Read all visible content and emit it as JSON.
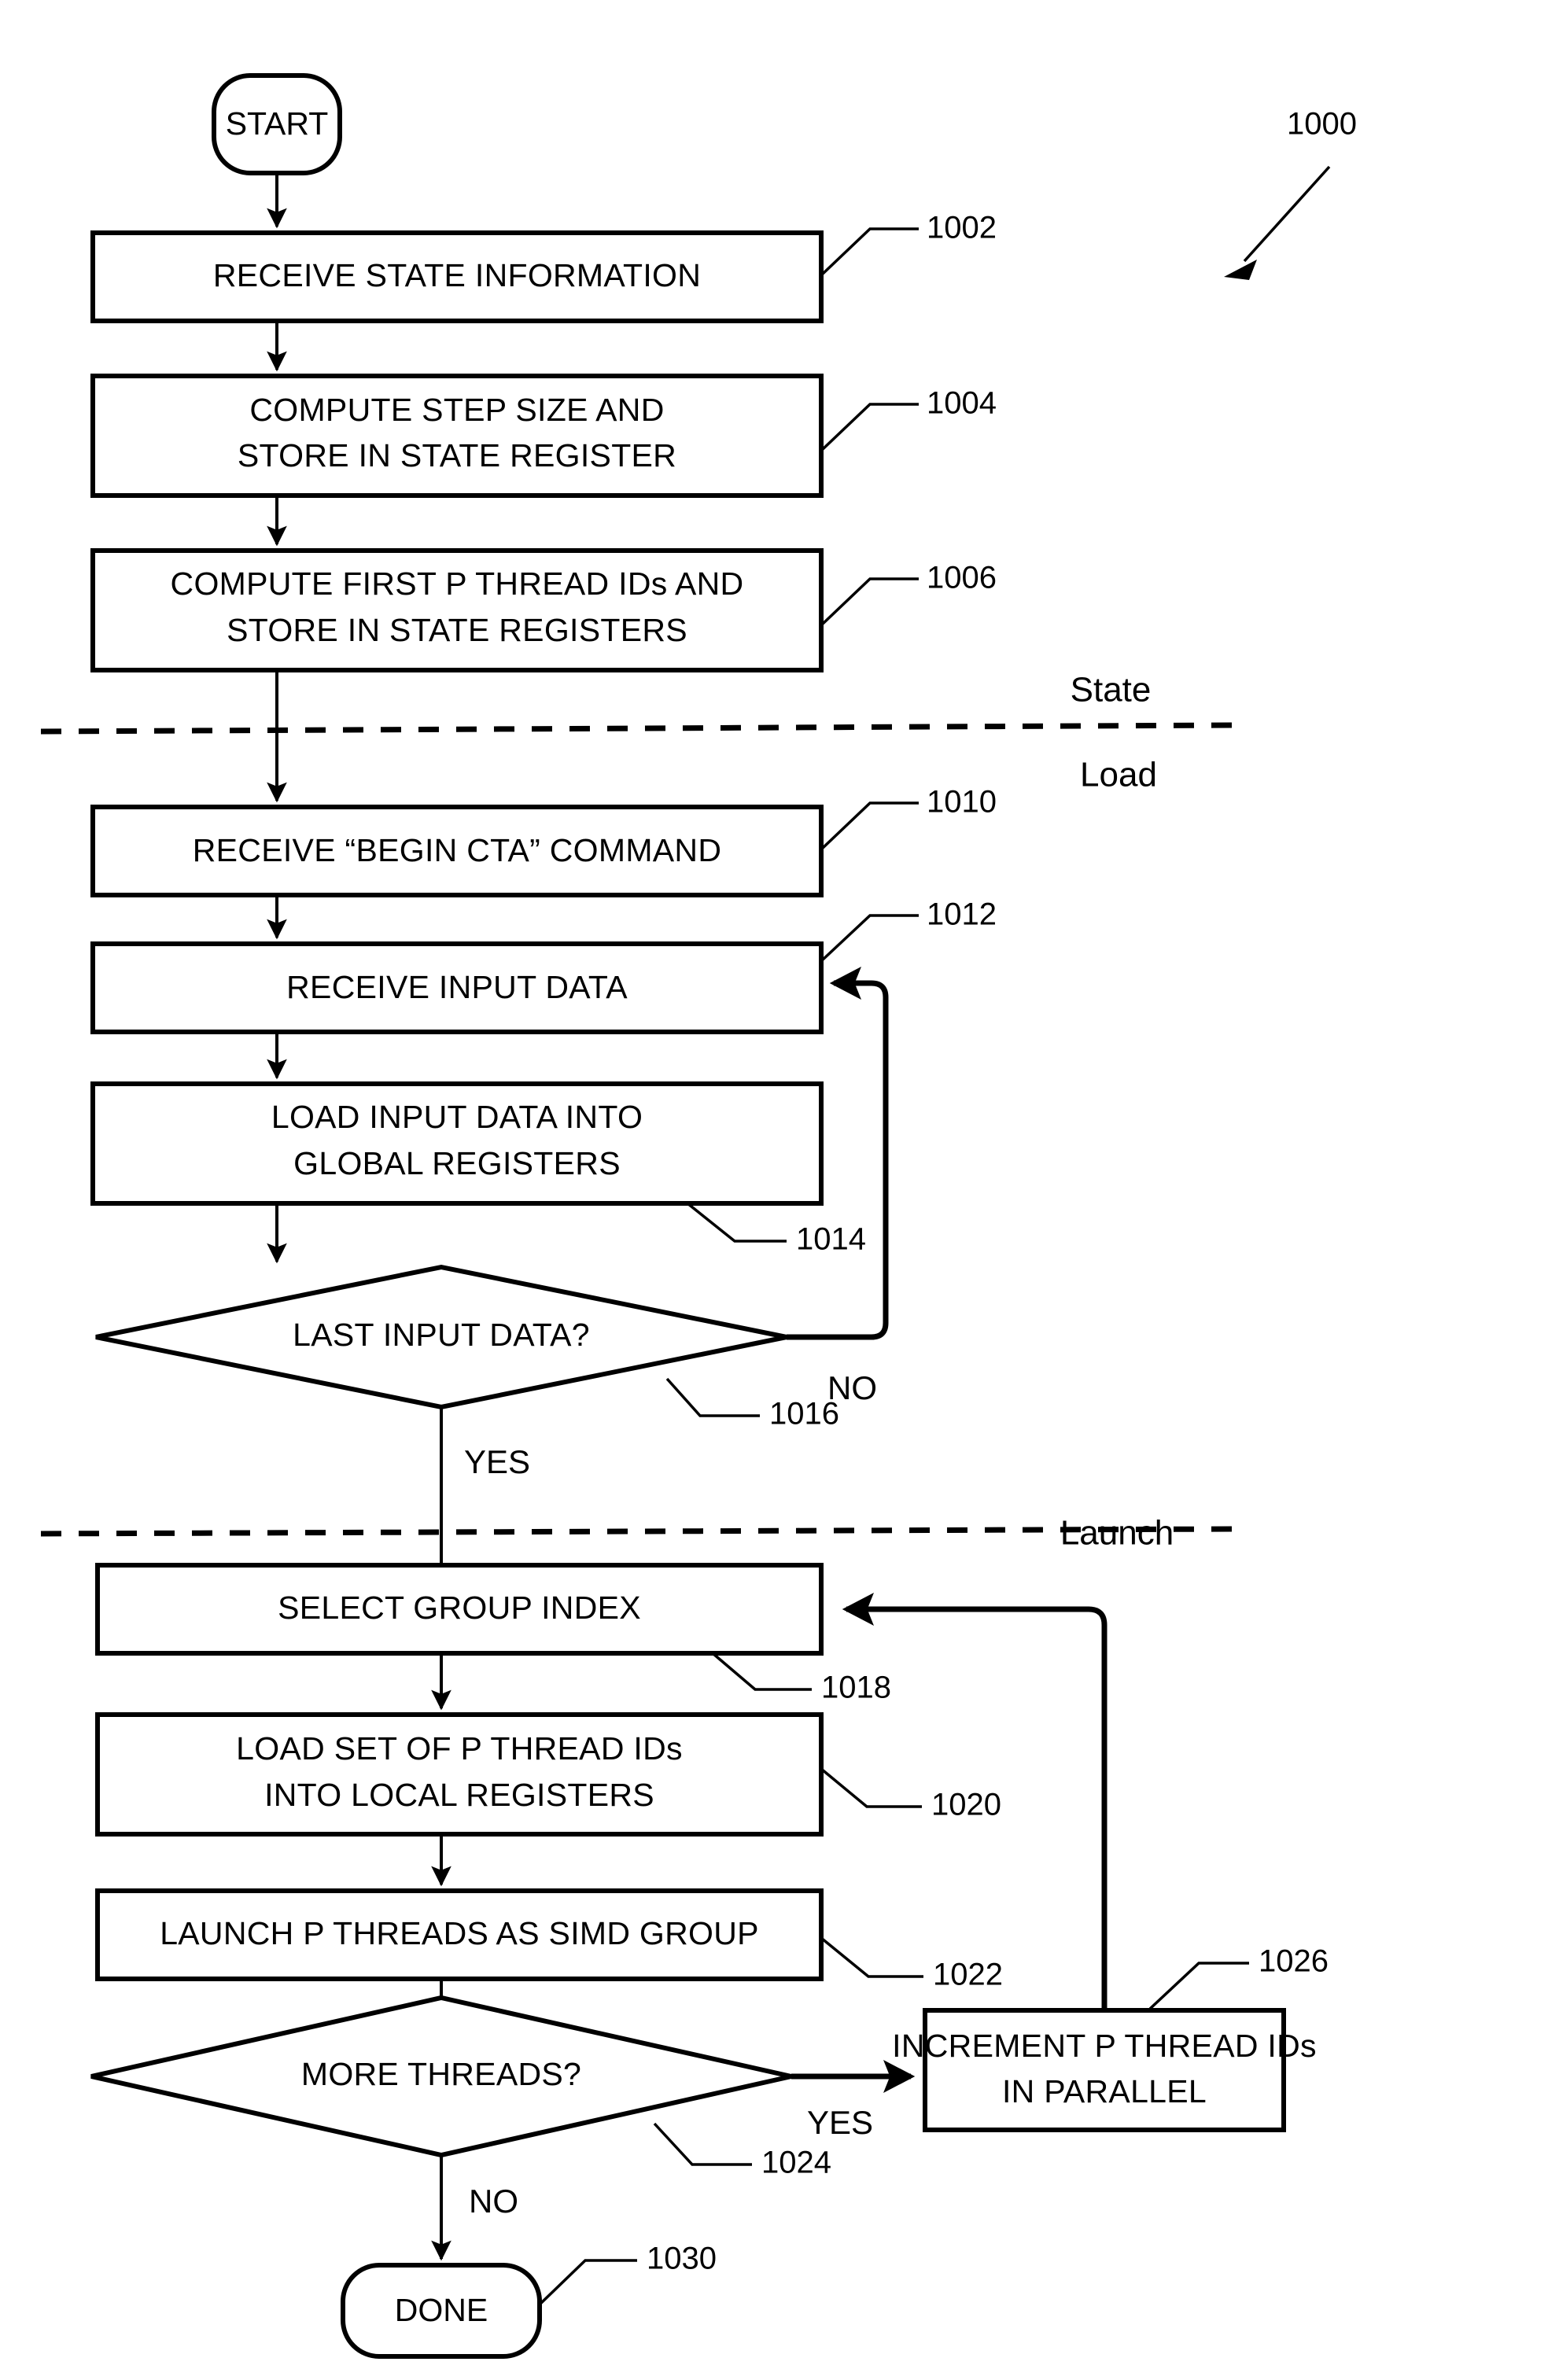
{
  "figure": {
    "reference_numeral": "1000",
    "phase_labels": [
      {
        "id": "state",
        "text": "State"
      },
      {
        "id": "load",
        "text": "Load"
      },
      {
        "id": "launch",
        "text": "Launch"
      }
    ]
  },
  "terminators": {
    "start": {
      "label": "START"
    },
    "done": {
      "label": "DONE",
      "ref": "1030"
    }
  },
  "steps": [
    {
      "id": "1002",
      "ref": "1002",
      "lines": [
        "RECEIVE STATE INFORMATION"
      ]
    },
    {
      "id": "1004",
      "ref": "1004",
      "lines": [
        "COMPUTE STEP SIZE AND",
        "STORE IN STATE REGISTER"
      ]
    },
    {
      "id": "1006",
      "ref": "1006",
      "lines": [
        "COMPUTE FIRST P THREAD IDs AND",
        "STORE IN STATE REGISTERS"
      ]
    },
    {
      "id": "1010",
      "ref": "1010",
      "lines": [
        "RECEIVE “BEGIN CTA” COMMAND"
      ]
    },
    {
      "id": "1012",
      "ref": "1012",
      "lines": [
        "RECEIVE INPUT DATA"
      ]
    },
    {
      "id": "1014",
      "ref": "1014",
      "lines": [
        "LOAD INPUT DATA INTO",
        "GLOBAL REGISTERS"
      ]
    },
    {
      "id": "1018",
      "ref": "1018",
      "lines": [
        "SELECT GROUP INDEX"
      ]
    },
    {
      "id": "1020",
      "ref": "1020",
      "lines": [
        "LOAD SET OF P THREAD IDs",
        "INTO LOCAL REGISTERS"
      ]
    },
    {
      "id": "1022",
      "ref": "1022",
      "lines": [
        "LAUNCH P THREADS AS SIMD GROUP"
      ]
    },
    {
      "id": "1026",
      "ref": "1026",
      "lines": [
        "INCREMENT P THREAD IDs",
        "IN PARALLEL"
      ]
    }
  ],
  "decisions": [
    {
      "id": "1016",
      "ref": "1016",
      "question": "LAST INPUT DATA?",
      "yes_label": "YES",
      "no_label": "NO"
    },
    {
      "id": "1024",
      "ref": "1024",
      "question": "MORE THREADS?",
      "yes_label": "YES",
      "no_label": "NO"
    }
  ],
  "colors": {
    "ink": "#000000",
    "paper": "#ffffff"
  }
}
